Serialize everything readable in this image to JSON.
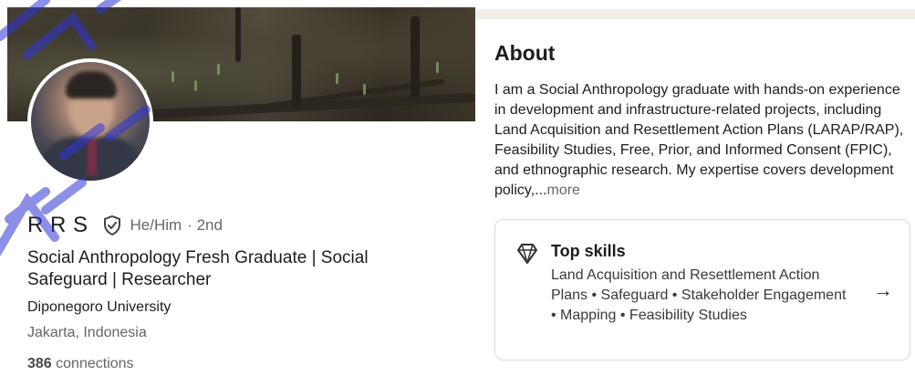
{
  "profile": {
    "name": "R R S",
    "pronouns": "He/Him",
    "degree": "· 2nd",
    "headline": "Social Anthropology Fresh Graduate | Social Safeguard | Researcher",
    "school": "Diponegoro University",
    "location": "Jakarta, Indonesia",
    "connections_count": "386",
    "connections_label": "connections"
  },
  "about": {
    "title": "About",
    "text": "I am a Social Anthropology graduate with hands-on experience in development and infrastructure-related projects, including Land Acquisition and Resettlement Action Plans (LARAP/RAP), Feasibility Studies, Free, Prior, and Informed Consent (FPIC), and ethnographic research. My expertise covers development policy,...",
    "more_label": "more"
  },
  "skills": {
    "title": "Top skills",
    "list": "Land Acquisition and Resettlement Action Plans  • Safeguard • Stakeholder Engagement • Mapping • Feasibility Studies",
    "arrow": "→"
  },
  "icons": {
    "verified": "verified-shield-icon",
    "diamond": "diamond-icon",
    "arrow": "arrow-right-icon"
  },
  "colors": {
    "text_primary": "#1d1d1d",
    "text_secondary": "#666666",
    "watermark": "#2f35d6"
  }
}
